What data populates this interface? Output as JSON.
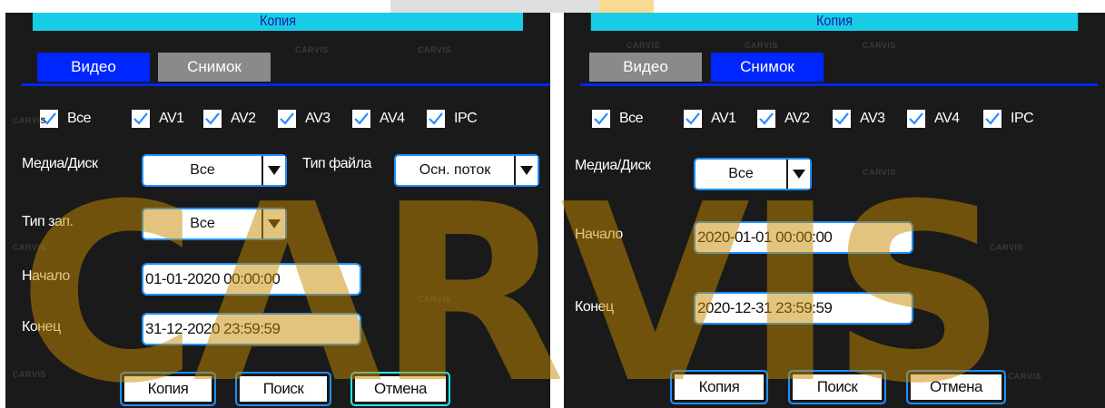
{
  "watermark": {
    "text": "CARVIS",
    "symbol": "ₐ",
    "color": "#3a3a3a"
  },
  "brand_overlay": {
    "text": "CARVIS",
    "color": "#c88a00"
  },
  "colors": {
    "title_bg": "#17cde6",
    "title_fg": "#1a1a9c",
    "tab_active": "#0026ff",
    "tab_inactive": "#8a8a8a",
    "field_border": "#1e90ff",
    "panel_bg": "#1a1a1a"
  },
  "left": {
    "title": "Копия",
    "tabs": [
      {
        "label": "Видео",
        "active": true
      },
      {
        "label": "Снимок",
        "active": false
      }
    ],
    "checkboxes": [
      {
        "label": "Все",
        "checked": true
      },
      {
        "label": "AV1",
        "checked": true
      },
      {
        "label": "AV2",
        "checked": true
      },
      {
        "label": "AV3",
        "checked": true
      },
      {
        "label": "AV4",
        "checked": true
      },
      {
        "label": "IPC",
        "checked": true
      }
    ],
    "media_label": "Медиа/Диск",
    "media_value": "Все",
    "file_type_label": "Тип файла",
    "file_type_value": "Осн. поток",
    "rec_type_label": "Тип зап.",
    "rec_type_value": "Все",
    "start_label": "Начало",
    "start_value": "01-01-2020 00:00:00",
    "end_label": "Конец",
    "end_value": "31-12-2020 23:59:59",
    "buttons": [
      {
        "label": "Копия"
      },
      {
        "label": "Поиск"
      },
      {
        "label": "Отмена"
      }
    ]
  },
  "right": {
    "title": "Копия",
    "tabs": [
      {
        "label": "Видео",
        "active": false
      },
      {
        "label": "Снимок",
        "active": true
      }
    ],
    "checkboxes": [
      {
        "label": "Все",
        "checked": true
      },
      {
        "label": "AV1",
        "checked": true
      },
      {
        "label": "AV2",
        "checked": true
      },
      {
        "label": "AV3",
        "checked": true
      },
      {
        "label": "AV4",
        "checked": true
      },
      {
        "label": "IPC",
        "checked": true
      }
    ],
    "media_label": "Медиа/Диск",
    "media_value": "Все",
    "start_label": "Начало",
    "start_value": "2020-01-01 00:00:00",
    "end_label": "Конец",
    "end_value": "2020-12-31 23:59:59",
    "buttons": [
      {
        "label": "Копия"
      },
      {
        "label": "Поиск"
      },
      {
        "label": "Отмена"
      }
    ]
  }
}
